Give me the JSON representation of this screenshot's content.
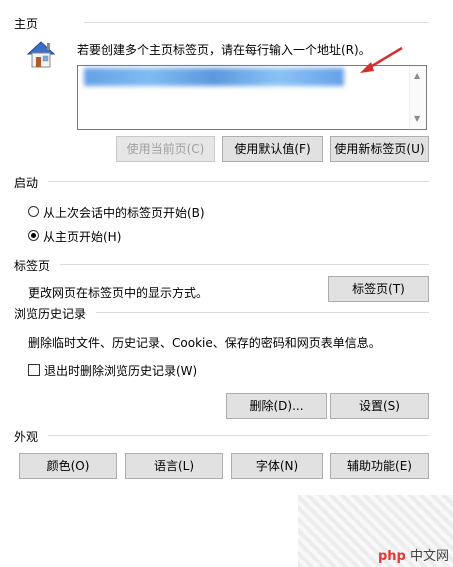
{
  "homepage": {
    "section_title": "主页",
    "description": "若要创建多个主页标签页，请在每行输入一个地址(R)。",
    "buttons": {
      "use_current": "使用当前页(C)",
      "use_default": "使用默认值(F)",
      "use_new_tab": "使用新标签页(U)"
    }
  },
  "startup": {
    "section_title": "启动",
    "options": [
      {
        "label": "从上次会话中的标签页开始(B)",
        "checked": false
      },
      {
        "label": "从主页开始(H)",
        "checked": true
      }
    ]
  },
  "tabs": {
    "section_title": "标签页",
    "description": "更改网页在标签页中的显示方式。",
    "button": "标签页(T)"
  },
  "history": {
    "section_title": "浏览历史记录",
    "description": "删除临时文件、历史记录、Cookie、保存的密码和网页表单信息。",
    "checkbox_label": "退出时删除浏览历史记录(W)",
    "checkbox_checked": false,
    "buttons": {
      "delete": "删除(D)...",
      "settings": "设置(S)"
    }
  },
  "appearance": {
    "section_title": "外观",
    "buttons": {
      "colors": "颜色(O)",
      "languages": "语言(L)",
      "fonts": "字体(N)",
      "accessibility": "辅助功能(E)"
    }
  },
  "watermark": {
    "brand": "php",
    "site": "中文网"
  },
  "colors": {
    "annotation_arrow": "#d32f2f",
    "blurred_url": "#4a90e2"
  }
}
